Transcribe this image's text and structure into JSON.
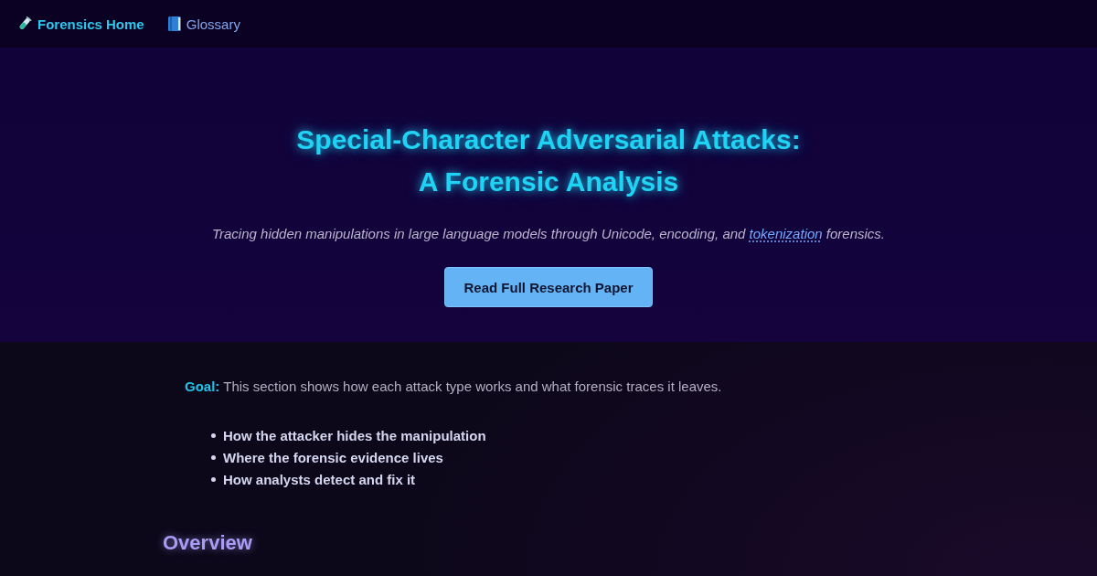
{
  "nav": {
    "links": [
      {
        "kind": "test-tube",
        "label": "Forensics Home",
        "selected": true
      },
      {
        "kind": "book",
        "label": "Glossary",
        "selected": false
      }
    ]
  },
  "hero": {
    "title_lines": [
      "Special-Character Adversarial Attacks:",
      "A Forensic Analysis"
    ],
    "subtitle": {
      "before": "Tracing hidden manipulations in large language models through Unicode, encoding, and",
      "link": "tokenization",
      "after": "forensics."
    },
    "button": "Read Full Research Paper"
  },
  "intro": {
    "goal": "**Goal:** This section shows how each attack type works and what forensic traces it leaves.",
    "points": [
      "How the attacker hides the manipulation",
      "Where the forensic evidence lives",
      "How analysts detect and fix it"
    ]
  },
  "section_heading": "Overview"
}
